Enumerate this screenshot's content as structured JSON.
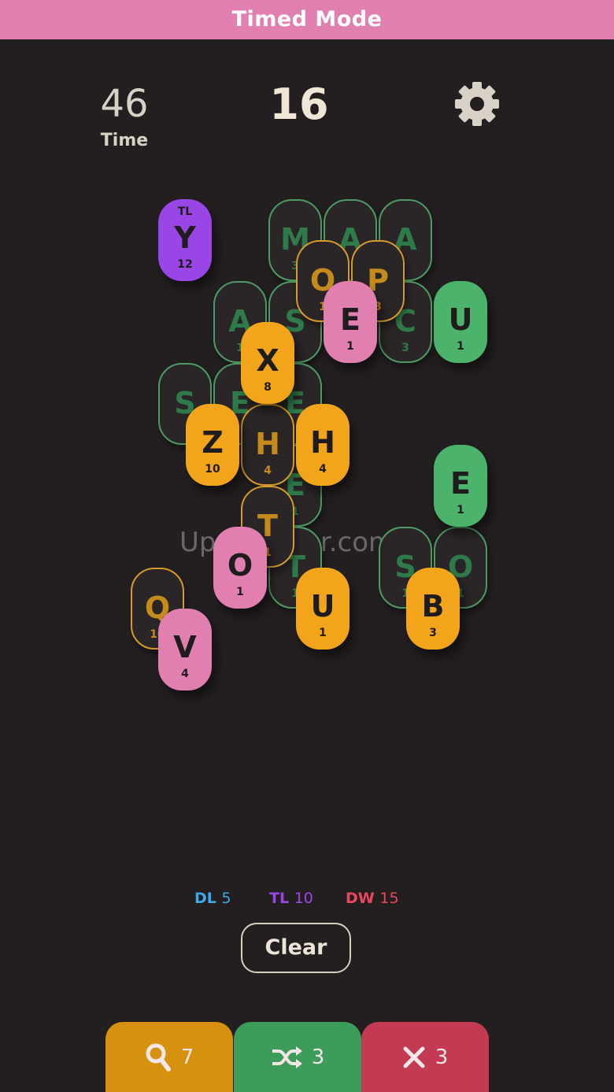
{
  "header": {
    "title": "Timed Mode"
  },
  "hud": {
    "time_value": "46",
    "time_label": "Time",
    "score": "16"
  },
  "icons": {
    "settings": "gear-icon",
    "hint": "search-icon",
    "shuffle": "shuffle-icon",
    "remove": "close-icon"
  },
  "colors": {
    "header_bg": "#e07fb0",
    "background": "#231f21",
    "tile_green": "#4bb36b",
    "tile_orange": "#f2a51a",
    "tile_pink": "#e07fb0",
    "tile_purple": "#9a46e6",
    "bonus_dl": "#3fa9e6",
    "bonus_tl": "#9a46e6",
    "bonus_dw": "#e8475f"
  },
  "board": {
    "tiles": [
      {
        "letter": "M",
        "points": "3",
        "color": "green",
        "state": "covered"
      },
      {
        "letter": "A",
        "points": "",
        "color": "green",
        "state": "covered"
      },
      {
        "letter": "A",
        "points": "",
        "color": "green",
        "state": "covered"
      },
      {
        "letter": "A",
        "points": "1",
        "color": "green",
        "state": "covered"
      },
      {
        "letter": "S",
        "points": "",
        "color": "green",
        "state": "covered"
      },
      {
        "letter": "C",
        "points": "3",
        "color": "green",
        "state": "covered"
      },
      {
        "letter": "S",
        "points": "",
        "color": "green",
        "state": "covered"
      },
      {
        "letter": "E",
        "points": "",
        "color": "green",
        "state": "covered"
      },
      {
        "letter": "E",
        "points": "",
        "color": "green",
        "state": "covered"
      },
      {
        "letter": "E",
        "points": "1",
        "color": "green",
        "state": "covered"
      },
      {
        "letter": "T",
        "points": "1",
        "color": "green",
        "state": "covered"
      },
      {
        "letter": "S",
        "points": "1",
        "color": "green",
        "state": "covered"
      },
      {
        "letter": "O",
        "points": "1",
        "color": "green",
        "state": "covered"
      },
      {
        "letter": "O",
        "points": "1",
        "color": "orange",
        "state": "covered"
      },
      {
        "letter": "P",
        "points": "3",
        "color": "orange",
        "state": "covered"
      },
      {
        "letter": "H",
        "points": "4",
        "color": "orange",
        "state": "covered"
      },
      {
        "letter": "T",
        "points": "1",
        "color": "orange",
        "state": "covered"
      },
      {
        "letter": "Q",
        "points": "10",
        "color": "orange",
        "state": "covered"
      },
      {
        "letter": "Y",
        "points": "12",
        "color": "purple",
        "state": "open",
        "bonus": "TL"
      },
      {
        "letter": "E",
        "points": "1",
        "color": "pink",
        "state": "open"
      },
      {
        "letter": "U",
        "points": "1",
        "color": "green",
        "state": "open"
      },
      {
        "letter": "X",
        "points": "8",
        "color": "orange",
        "state": "open"
      },
      {
        "letter": "Z",
        "points": "10",
        "color": "orange",
        "state": "open"
      },
      {
        "letter": "H",
        "points": "4",
        "color": "orange",
        "state": "open"
      },
      {
        "letter": "E",
        "points": "1",
        "color": "green",
        "state": "open"
      },
      {
        "letter": "O",
        "points": "1",
        "color": "pink",
        "state": "open"
      },
      {
        "letter": "U",
        "points": "1",
        "color": "orange",
        "state": "open"
      },
      {
        "letter": "B",
        "points": "3",
        "color": "orange",
        "state": "open"
      },
      {
        "letter": "V",
        "points": "4",
        "color": "pink",
        "state": "open"
      }
    ]
  },
  "watermark": "UpdateStar.com",
  "bonuses": {
    "dl_label": "DL",
    "dl_value": "5",
    "tl_label": "TL",
    "tl_value": "10",
    "dw_label": "DW",
    "dw_value": "15"
  },
  "actions": {
    "clear_label": "Clear"
  },
  "powerups": {
    "hint_count": "7",
    "shuffle_count": "3",
    "remove_count": "3"
  }
}
